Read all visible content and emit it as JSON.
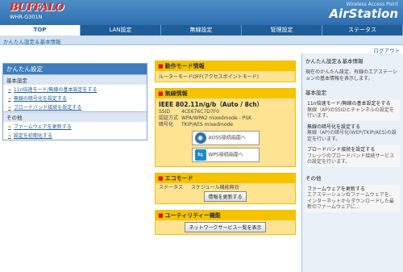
{
  "header": {
    "logo": "BUFFALO",
    "model": "WHR-G301N",
    "brand_sub": "Wireless Access Point",
    "brand": "AirStation"
  },
  "tabs": [
    {
      "label": "TOP",
      "active": true
    },
    {
      "label": "LAN設定",
      "active": false
    },
    {
      "label": "無線設定",
      "active": false
    },
    {
      "label": "管理設定",
      "active": false
    },
    {
      "label": "ステータス",
      "active": false
    }
  ],
  "breadcrumb": "かんたん設定＆基本情報",
  "logout": "ログアウト",
  "left_panel": {
    "title": "かんたん設定",
    "section1": "基本設定",
    "items1": [
      "11n倍速モード/無線の基本設定をする",
      "無線の暗号化を設定する",
      "ブロードバンド接続を設定する"
    ],
    "section2": "その他",
    "items2": [
      "ファームウェアを更新する",
      "設定を初期化する"
    ]
  },
  "boxes": {
    "mode": {
      "title": "動作モード情報",
      "text": "ルーターモードOFF(アクセスポイントモード)"
    },
    "wireless": {
      "title": "無線情報",
      "standard": "IEEE 802.11n/g/b（Auto / 8ch）",
      "rows": [
        {
          "k": "SSID",
          "v": "4CE676C7D7F0"
        },
        {
          "k": "認証方式",
          "v": "WPA/WPA2 mixedmode - PSK"
        },
        {
          "k": "暗号化",
          "v": "TKIP/AES mixedmode"
        }
      ],
      "aoss_label": "AOSS接続画面へ",
      "wps_label": "WPS接続画面へ"
    },
    "eco": {
      "title": "エコモード",
      "status_key": "ステータス",
      "status_val": "スケジュール機能無効",
      "button": "情報を更新する"
    },
    "utility": {
      "title": "ユーティリティー機能",
      "button": "ネットワークサービス一覧を表示"
    }
  },
  "help": {
    "title": "かんたん設定＆基本情報",
    "intro": "現在のかんたん設定、有線のエアステーションの基本情報を表示します。",
    "section1": "基本設定",
    "items": [
      {
        "head": "11n倍速モード/無線の基本設定をする",
        "sub": "無線（AP)のSSIDとチャンネルの設定を行います。"
      },
      {
        "head": "無線の暗号化を設定する",
        "sub": "無線（AP)の暗号化(WEP/TKIP/AES)の設定を行います。"
      },
      {
        "head": "ブロードバンド接続を設定する",
        "sub": "フレッツのブロードバンド接続サービスの設定を行います。"
      }
    ],
    "section2": "その他",
    "items2": [
      {
        "head": "ファームウェアを更新する",
        "sub": "エアステーションのファームウェアを、インターネットからダウンロードした最新のファームウェアに..."
      }
    ]
  },
  "colors": {
    "header": "#2f6fb0",
    "tab_bar": "#1f5d98",
    "box_bg": "#fde392",
    "box_title": "#f6c300",
    "logo": "#e8231c"
  }
}
